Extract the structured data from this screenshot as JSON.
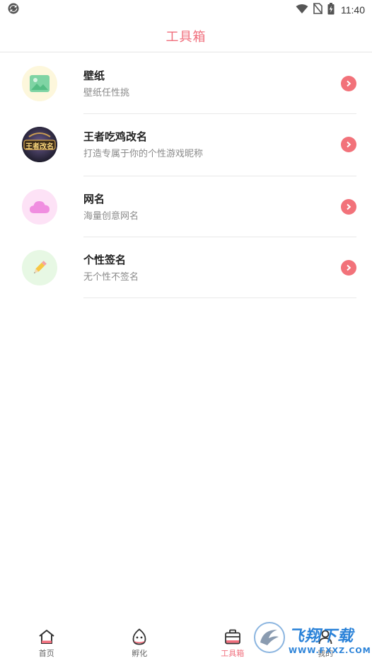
{
  "status_bar": {
    "time": "11:40"
  },
  "header": {
    "title": "工具箱"
  },
  "tools": [
    {
      "title": "壁纸",
      "subtitle": "壁纸任性挑",
      "icon": "wallpaper-image-icon",
      "icon_bg": "#fdf7dc"
    },
    {
      "title": "王者吃鸡改名",
      "subtitle": "打造专属于你的个性游戏昵称",
      "icon": "game-rename-badge",
      "icon_bg": "#2a2a3a",
      "badge_text": "王者改名"
    },
    {
      "title": "网名",
      "subtitle": "海量创意网名",
      "icon": "cloud-icon",
      "icon_bg": "#fde2f6"
    },
    {
      "title": "个性签名",
      "subtitle": "无个性不签名",
      "icon": "pencil-icon",
      "icon_bg": "#e7f8e4"
    }
  ],
  "nav": [
    {
      "label": "首页",
      "icon": "home-icon"
    },
    {
      "label": "孵化",
      "icon": "egg-icon"
    },
    {
      "label": "工具箱",
      "icon": "toolbox-icon",
      "active": true
    },
    {
      "label": "我的",
      "icon": "profile-icon"
    }
  ],
  "watermark": {
    "name": "飞翔下载",
    "url": "WWW.FXXZ.COM"
  },
  "colors": {
    "accent": "#f06f7d",
    "arrow": "#f2727a",
    "divider": "#e8e8e8"
  }
}
